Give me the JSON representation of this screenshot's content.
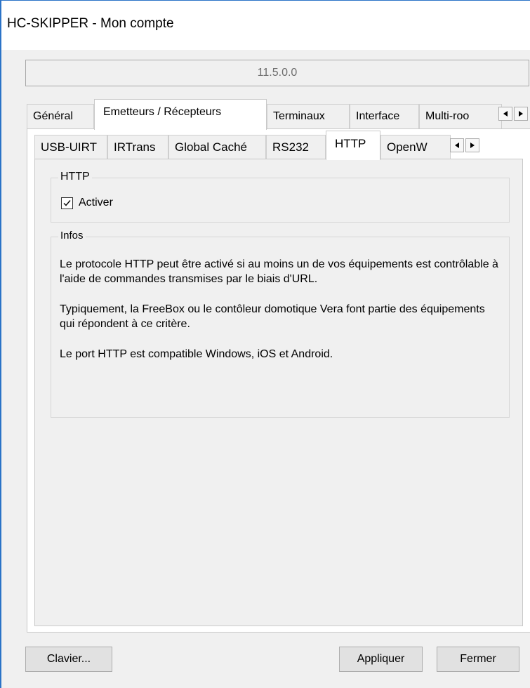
{
  "window": {
    "title": "HC-SKIPPER - Mon compte"
  },
  "version": "11.5.0.0",
  "outer_tabs": [
    {
      "label": "Général"
    },
    {
      "label": "Emetteurs / Récepteurs"
    },
    {
      "label": "Terminaux"
    },
    {
      "label": "Interface"
    },
    {
      "label": "Multi-roo"
    }
  ],
  "inner_tabs": [
    {
      "label": "USB-UIRT"
    },
    {
      "label": "IRTrans"
    },
    {
      "label": "Global Caché"
    },
    {
      "label": "RS232"
    },
    {
      "label": "HTTP"
    },
    {
      "label": "OpenW"
    }
  ],
  "http_group": {
    "legend": "HTTP",
    "checkbox_label": "Activer",
    "checked": true
  },
  "info_group": {
    "legend": "Infos",
    "paragraphs": [
      "Le protocole HTTP peut être activé si au moins un de vos équipements est contrôlable à l'aide de commandes transmises par le biais d'URL.",
      "Typiquement, la FreeBox ou le contôleur domotique Vera font partie des équipements qui répondent à ce critère.",
      "Le port HTTP est compatible Windows, iOS et Android."
    ]
  },
  "buttons": {
    "keyboard": "Clavier...",
    "apply": "Appliquer",
    "close": "Fermer"
  },
  "icons": {
    "scroll_left": "arrow-left-icon",
    "scroll_right": "arrow-right-icon",
    "check": "checkmark-icon"
  }
}
